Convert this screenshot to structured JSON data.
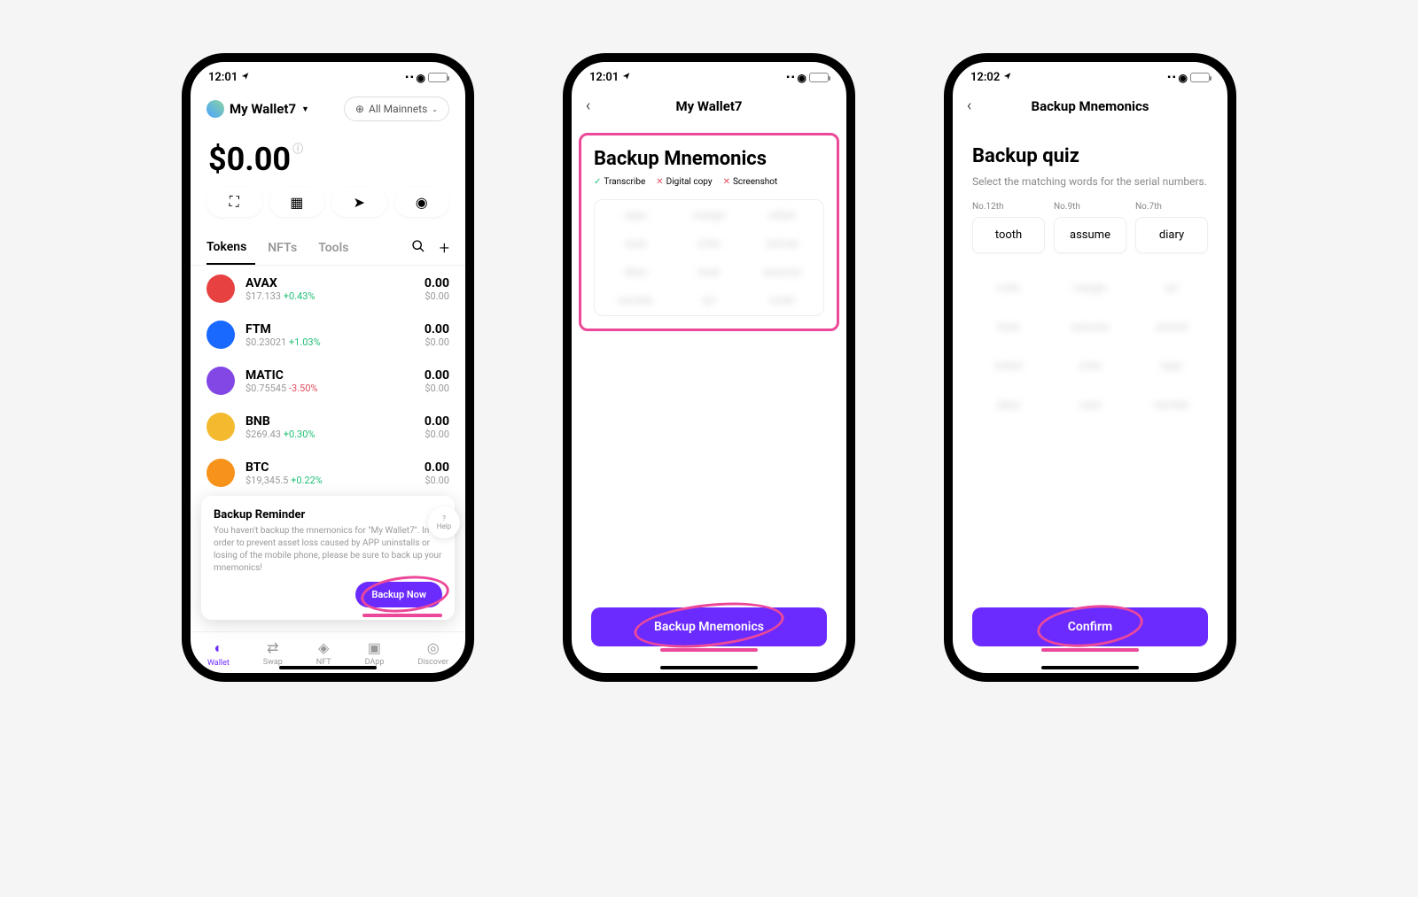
{
  "screen1": {
    "status_time": "12:01",
    "wallet_name": "My Wallet7",
    "network_label": "All Mainnets",
    "balance": "$0.00",
    "tabs": {
      "tokens": "Tokens",
      "nfts": "NFTs",
      "tools": "Tools"
    },
    "tokens": [
      {
        "symbol": "AVAX",
        "price": "$17.133",
        "change": "+0.43%",
        "pos": true,
        "amount": "0.00",
        "usd": "$0.00",
        "color": "#e84142"
      },
      {
        "symbol": "FTM",
        "price": "$0.23021",
        "change": "+1.03%",
        "pos": true,
        "amount": "0.00",
        "usd": "$0.00",
        "color": "#1969ff"
      },
      {
        "symbol": "MATIC",
        "price": "$0.75545",
        "change": "-3.50%",
        "pos": false,
        "amount": "0.00",
        "usd": "$0.00",
        "color": "#8247e5"
      },
      {
        "symbol": "BNB",
        "price": "$269.43",
        "change": "+0.30%",
        "pos": true,
        "amount": "0.00",
        "usd": "$0.00",
        "color": "#f3ba2f"
      },
      {
        "symbol": "BTC",
        "price": "$19,345.5",
        "change": "+0.22%",
        "pos": true,
        "amount": "0.00",
        "usd": "$0.00",
        "color": "#f7931a"
      }
    ],
    "popup": {
      "title": "Backup Reminder",
      "text": "You haven't backup the mnemonics for \"My Wallet7\". In order to prevent asset loss caused by APP uninstalls or losing of the mobile phone, please be sure to back up your mnemonics!",
      "button": "Backup Now",
      "help": "Help"
    },
    "nav": {
      "wallet": "Wallet",
      "swap": "Swap",
      "nft": "NFT",
      "dapp": "DApp",
      "discover": "Discover"
    }
  },
  "screen2": {
    "status_time": "12:01",
    "header": "My Wallet7",
    "title": "Backup Mnemonics",
    "hints": {
      "transcribe": "Transcribe",
      "digital": "Digital copy",
      "screenshot": "Screenshot"
    },
    "words": [
      "tape",
      "margin",
      "infant",
      "case",
      "critic",
      "animal",
      "diary",
      "boat",
      "assume",
      "wonder",
      "art",
      "tooth"
    ],
    "button": "Backup Mnemonics"
  },
  "screen3": {
    "status_time": "12:02",
    "header": "Backup Mnemonics",
    "title": "Backup quiz",
    "subtitle": "Select the matching words for the serial numbers.",
    "slots": [
      {
        "label": "No.12th",
        "word": "tooth"
      },
      {
        "label": "No.9th",
        "word": "assume"
      },
      {
        "label": "No.7th",
        "word": "diary"
      }
    ],
    "options": [
      "critic",
      "margin",
      "art",
      "boat",
      "assume",
      "animal",
      "infant",
      "critic",
      "tape",
      "diary",
      "case",
      "wonder"
    ],
    "button": "Confirm"
  }
}
